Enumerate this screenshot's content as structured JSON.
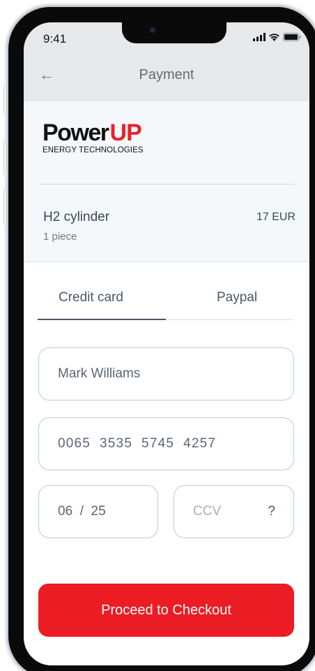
{
  "status_bar": {
    "time": "9:41",
    "icons": [
      "signal-icon",
      "wifi-icon",
      "battery-icon"
    ]
  },
  "header": {
    "back_icon": "←",
    "title": "Payment"
  },
  "brand": {
    "name_part1": "Power",
    "name_part2": "UP",
    "tagline": "ENERGY TECHNOLOGIES",
    "accent_color": "#ec1c24"
  },
  "order": {
    "product_name": "H2 cylinder",
    "quantity": "1 piece",
    "price": "17 EUR"
  },
  "tabs": [
    {
      "label": "Credit card",
      "active": true
    },
    {
      "label": "Paypal",
      "active": false
    }
  ],
  "form": {
    "cardholder_name": "Mark Williams",
    "card_number": "0065  3535  5745  4257",
    "expiry": "06  /  25",
    "ccv_placeholder": "CCV",
    "ccv_help": "?"
  },
  "checkout": {
    "label": "Proceed to Checkout"
  }
}
